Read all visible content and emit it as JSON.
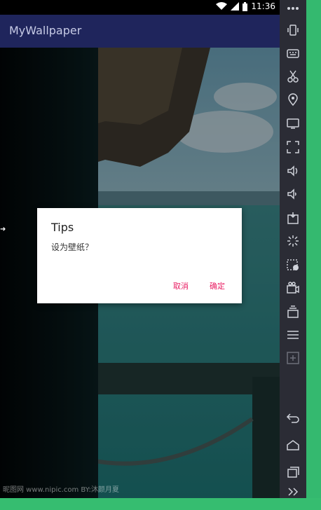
{
  "status": {
    "time": "11:36",
    "wifi_icon": "wifi-icon",
    "cell_icon": "signal-icon",
    "battery_icon": "battery-icon"
  },
  "app": {
    "title": "MyWallpaper"
  },
  "dialog": {
    "title": "Tips",
    "message": "设为壁纸？",
    "cancel_label": "取消",
    "ok_label": "确定",
    "accent": "#e91e63"
  },
  "wallpaper": {
    "watermark": "昵图网 www.nipic.com   BY:沐颜月夏"
  },
  "emulator_toolbar": {
    "items": [
      "more-icon",
      "shake-icon",
      "keyboard-icon",
      "screenshot-icon",
      "location-icon",
      "screen-icon",
      "fullscreen-icon",
      "volume-up-icon",
      "volume-down-icon",
      "apk-install-icon",
      "loading-icon",
      "record-icon",
      "camera-icon",
      "multi-instance-icon",
      "menu-icon",
      "add-icon",
      "back-icon",
      "home-icon",
      "recents-icon",
      "expand-icon"
    ]
  },
  "colors": {
    "appbar": "#1f255c",
    "toolbar": "#2b2c35",
    "frame": "#2fb36a"
  }
}
